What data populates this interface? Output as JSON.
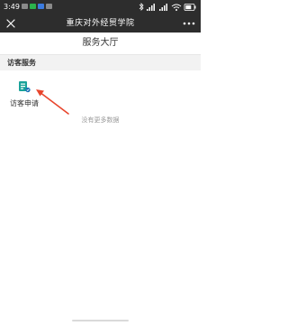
{
  "status_bar": {
    "time": "3:49"
  },
  "title_bar": {
    "title": "重庆对外经贸学院"
  },
  "page": {
    "title": "服务大厅"
  },
  "section": {
    "title": "访客服务"
  },
  "services": [
    {
      "label": "访客申请",
      "icon": "visitor-form-icon"
    }
  ],
  "empty_note": "没有更多数据",
  "colors": {
    "bar": "#2d2d2d",
    "section_bg": "#f2f2f2",
    "icon_accent": "#1aa39a",
    "arrow": "#e8452c"
  }
}
